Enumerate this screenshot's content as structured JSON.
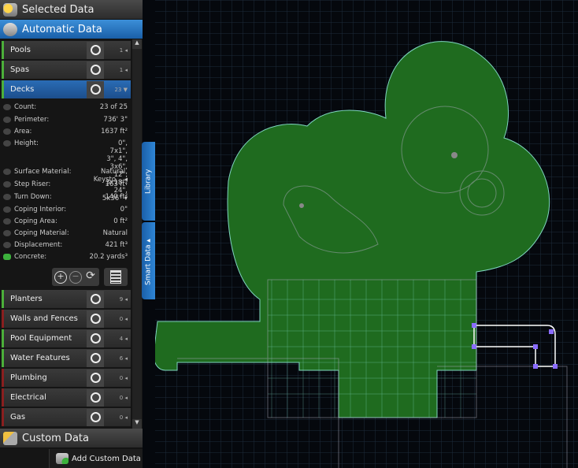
{
  "panel": {
    "selected_title": "Selected Data",
    "automatic_title": "Automatic Data",
    "custom_title": "Custom Data",
    "add_custom": "Add Custom Data",
    "top_rows": [
      {
        "label": "Pools",
        "count": "1",
        "status": "green"
      },
      {
        "label": "Spas",
        "count": "1",
        "status": "green"
      },
      {
        "label": "Decks",
        "count": "23",
        "status": "green",
        "expanded": true
      }
    ],
    "details": [
      {
        "k": "Count:",
        "v": "23 of 25"
      },
      {
        "k": "Perimeter:",
        "v": "736' 3\""
      },
      {
        "k": "Area:",
        "v": "1637 ft²"
      },
      {
        "k": "Height:",
        "v": "0\", 7x1\", 3\", 4\", 3x6\", 12\", 3x18\", 24\", 5x36\""
      },
      {
        "k": "Surface Material:",
        "v": "Natural, Keysto..."
      },
      {
        "k": "Step Riser:",
        "v": "163 ft²"
      },
      {
        "k": "Turn Down:",
        "v": "140 ft²"
      },
      {
        "k": "Coping Interior:",
        "v": "0\""
      },
      {
        "k": "Coping Area:",
        "v": "0 ft²"
      },
      {
        "k": "Coping Material:",
        "v": "Natural"
      },
      {
        "k": "Displacement:",
        "v": "421 ft³"
      },
      {
        "k": "Concrete:",
        "v": "20.2 yards³"
      }
    ],
    "bottom_rows": [
      {
        "label": "Planters",
        "count": "9",
        "status": "green"
      },
      {
        "label": "Walls and Fences",
        "count": "0",
        "status": "red"
      },
      {
        "label": "Pool Equipment",
        "count": "4",
        "status": "green"
      },
      {
        "label": "Water Features",
        "count": "6",
        "status": "green"
      },
      {
        "label": "Plumbing",
        "count": "0",
        "status": "red"
      },
      {
        "label": "Electrical",
        "count": "0",
        "status": "red"
      },
      {
        "label": "Gas",
        "count": "0",
        "status": "red"
      }
    ]
  },
  "tabs": {
    "library": "Library",
    "smart_data": "Smart Data"
  },
  "colors": {
    "accent": "#2f86d6",
    "deck_fill": "#1f6b1f",
    "grid": "#1a2a3a",
    "selection": "#8a6cff"
  }
}
